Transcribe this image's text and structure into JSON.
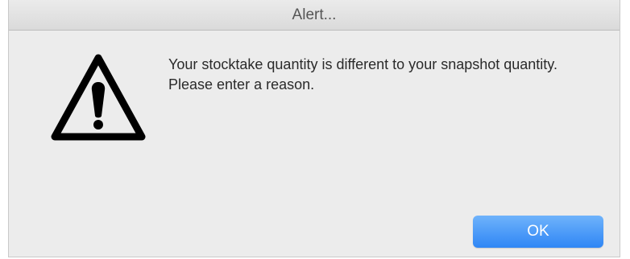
{
  "window": {
    "title": "Alert..."
  },
  "alert": {
    "icon": "warning-icon",
    "message": "Your stocktake quantity is different to your snapshot quantity. Please enter a reason."
  },
  "buttons": {
    "ok_label": "OK"
  },
  "colors": {
    "dialog_background": "#ececec",
    "button_accent": "#2f86f5",
    "icon_color": "#000000"
  }
}
